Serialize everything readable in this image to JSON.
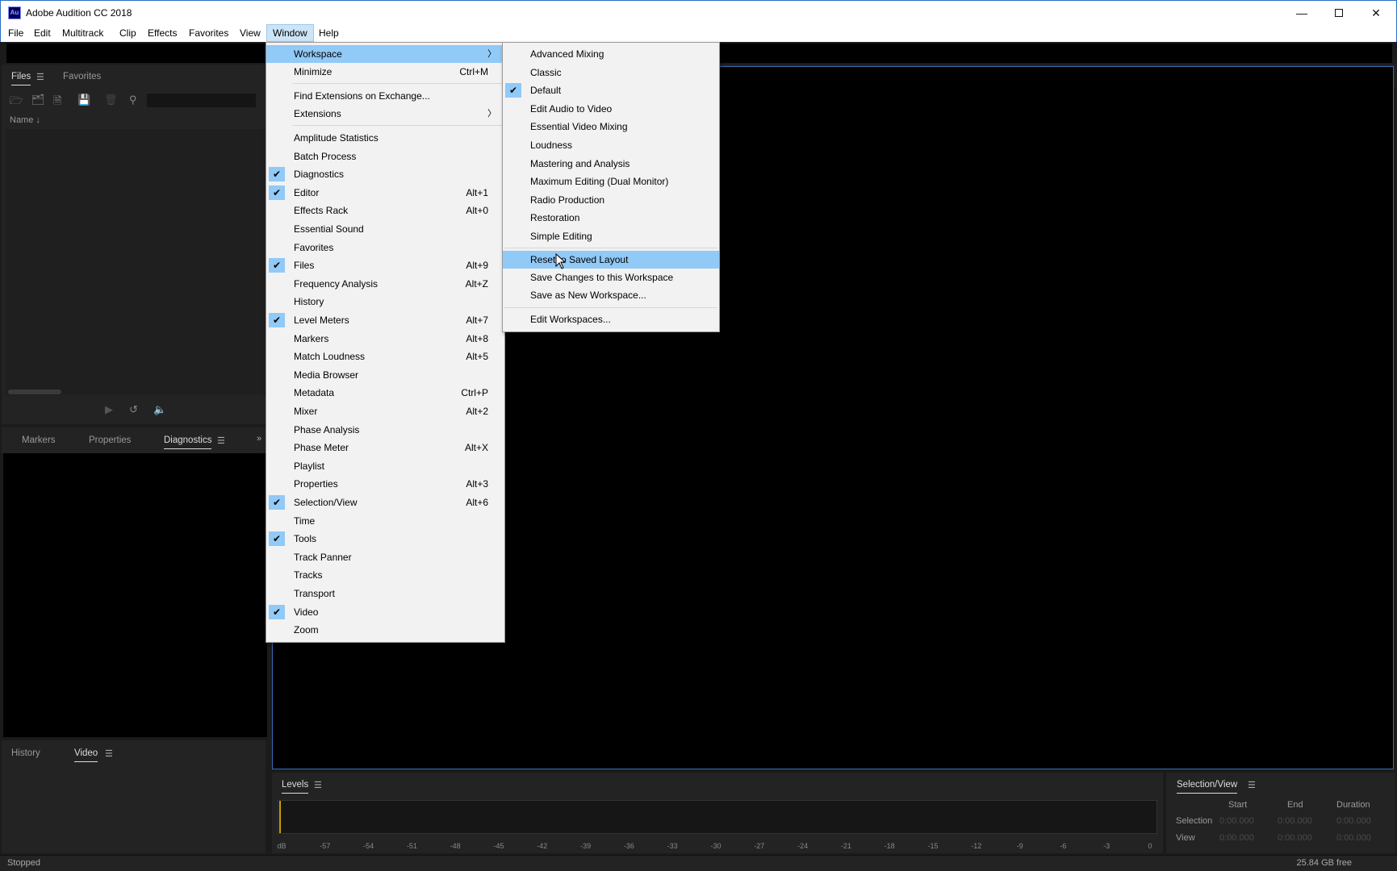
{
  "window": {
    "title": "Adobe Audition CC 2018",
    "app_icon_text": "Au"
  },
  "menubar": [
    "File",
    "Edit",
    "Multitrack",
    "Clip",
    "Effects",
    "Favorites",
    "View",
    "Window",
    "Help"
  ],
  "files_panel": {
    "tabs": [
      "Files",
      "Favorites"
    ],
    "column_header": "Name ↓"
  },
  "lower_panel_tabs": [
    "Markers",
    "Properties",
    "Diagnostics"
  ],
  "bottom_panel_tabs": [
    "History",
    "Video"
  ],
  "levels": {
    "title": "Levels",
    "ticks": [
      "dB",
      "-57",
      "-54",
      "-51",
      "-48",
      "-45",
      "-42",
      "-39",
      "-36",
      "-33",
      "-30",
      "-27",
      "-24",
      "-21",
      "-18",
      "-15",
      "-12",
      "-9",
      "-6",
      "-3",
      "0"
    ]
  },
  "selection_view": {
    "title": "Selection/View",
    "headers": [
      "Start",
      "End",
      "Duration"
    ],
    "rows": [
      {
        "label": "Selection",
        "start": "0:00.000",
        "end": "0:00.000",
        "duration": "0:00.000"
      },
      {
        "label": "View",
        "start": "0:00.000",
        "end": "0:00.000",
        "duration": "0:00.000"
      }
    ]
  },
  "status": {
    "left": "Stopped",
    "right": "25.84 GB free"
  },
  "window_menu": {
    "workspace": "Workspace",
    "minimize": "Minimize",
    "minimize_sc": "Ctrl+M",
    "find_ext": "Find Extensions on Exchange...",
    "extensions": "Extensions",
    "panels": [
      {
        "label": "Amplitude Statistics",
        "sc": "",
        "checked": false
      },
      {
        "label": "Batch Process",
        "sc": "",
        "checked": false
      },
      {
        "label": "Diagnostics",
        "sc": "",
        "checked": true
      },
      {
        "label": "Editor",
        "sc": "Alt+1",
        "checked": true
      },
      {
        "label": "Effects Rack",
        "sc": "Alt+0",
        "checked": false
      },
      {
        "label": "Essential Sound",
        "sc": "",
        "checked": false
      },
      {
        "label": "Favorites",
        "sc": "",
        "checked": false
      },
      {
        "label": "Files",
        "sc": "Alt+9",
        "checked": true
      },
      {
        "label": "Frequency Analysis",
        "sc": "Alt+Z",
        "checked": false
      },
      {
        "label": "History",
        "sc": "",
        "checked": false
      },
      {
        "label": "Level Meters",
        "sc": "Alt+7",
        "checked": true
      },
      {
        "label": "Markers",
        "sc": "Alt+8",
        "checked": false
      },
      {
        "label": "Match Loudness",
        "sc": "Alt+5",
        "checked": false
      },
      {
        "label": "Media Browser",
        "sc": "",
        "checked": false
      },
      {
        "label": "Metadata",
        "sc": "Ctrl+P",
        "checked": false
      },
      {
        "label": "Mixer",
        "sc": "Alt+2",
        "checked": false
      },
      {
        "label": "Phase Analysis",
        "sc": "",
        "checked": false
      },
      {
        "label": "Phase Meter",
        "sc": "Alt+X",
        "checked": false
      },
      {
        "label": "Playlist",
        "sc": "",
        "checked": false
      },
      {
        "label": "Properties",
        "sc": "Alt+3",
        "checked": false
      },
      {
        "label": "Selection/View",
        "sc": "Alt+6",
        "checked": true
      },
      {
        "label": "Time",
        "sc": "",
        "checked": false
      },
      {
        "label": "Tools",
        "sc": "",
        "checked": true
      },
      {
        "label": "Track Panner",
        "sc": "",
        "checked": false
      },
      {
        "label": "Tracks",
        "sc": "",
        "checked": false
      },
      {
        "label": "Transport",
        "sc": "",
        "checked": false
      },
      {
        "label": "Video",
        "sc": "",
        "checked": true
      },
      {
        "label": "Zoom",
        "sc": "",
        "checked": false
      }
    ]
  },
  "workspace_menu": {
    "workspaces": [
      {
        "label": "Advanced Mixing",
        "checked": false
      },
      {
        "label": "Classic",
        "checked": false
      },
      {
        "label": "Default",
        "checked": true
      },
      {
        "label": "Edit Audio to Video",
        "checked": false
      },
      {
        "label": "Essential Video Mixing",
        "checked": false
      },
      {
        "label": "Loudness",
        "checked": false
      },
      {
        "label": "Mastering and Analysis",
        "checked": false
      },
      {
        "label": "Maximum Editing (Dual Monitor)",
        "checked": false
      },
      {
        "label": "Radio Production",
        "checked": false
      },
      {
        "label": "Restoration",
        "checked": false
      },
      {
        "label": "Simple Editing",
        "checked": false
      }
    ],
    "actions": [
      "Reset to Saved Layout",
      "Save Changes to this Workspace",
      "Save as New Workspace..."
    ],
    "edit": "Edit Workspaces..."
  }
}
